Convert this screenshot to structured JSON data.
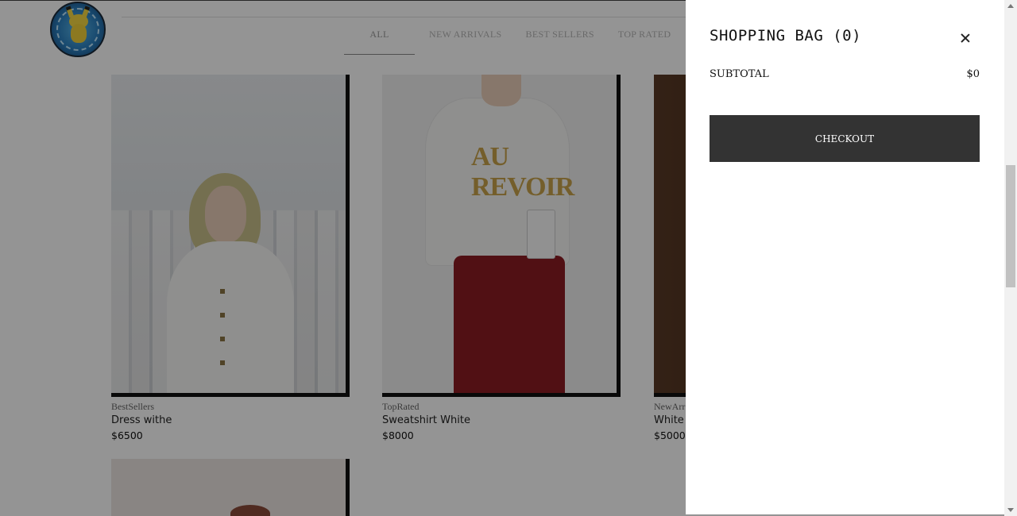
{
  "nav": {
    "items": [
      "ALL",
      "NEW ARRIVALS",
      "BEST SELLERS",
      "TOP RATED"
    ],
    "active": "ALL"
  },
  "products": [
    {
      "category": "BestSellers",
      "name": "Dress withe",
      "price": "$6500"
    },
    {
      "category": "TopRated",
      "name": "Sweatshirt White",
      "price": "$8000"
    },
    {
      "category": "NewArr",
      "name": "White",
      "price": "$5000"
    }
  ],
  "photo_text": {
    "sweatshirt_print": "AU REVOIR"
  },
  "cart": {
    "title": "SHOPPING BAG (0)",
    "subtotal_label": "SUBTOTAL",
    "subtotal_value": "$0",
    "checkout_label": "CHECKOUT"
  },
  "colors": {
    "overlay": "#000000",
    "checkout_bg": "#333333",
    "drawer_bg": "#ffffff"
  },
  "icons": {
    "close": "close-icon",
    "logo": "pikachu-logo"
  }
}
